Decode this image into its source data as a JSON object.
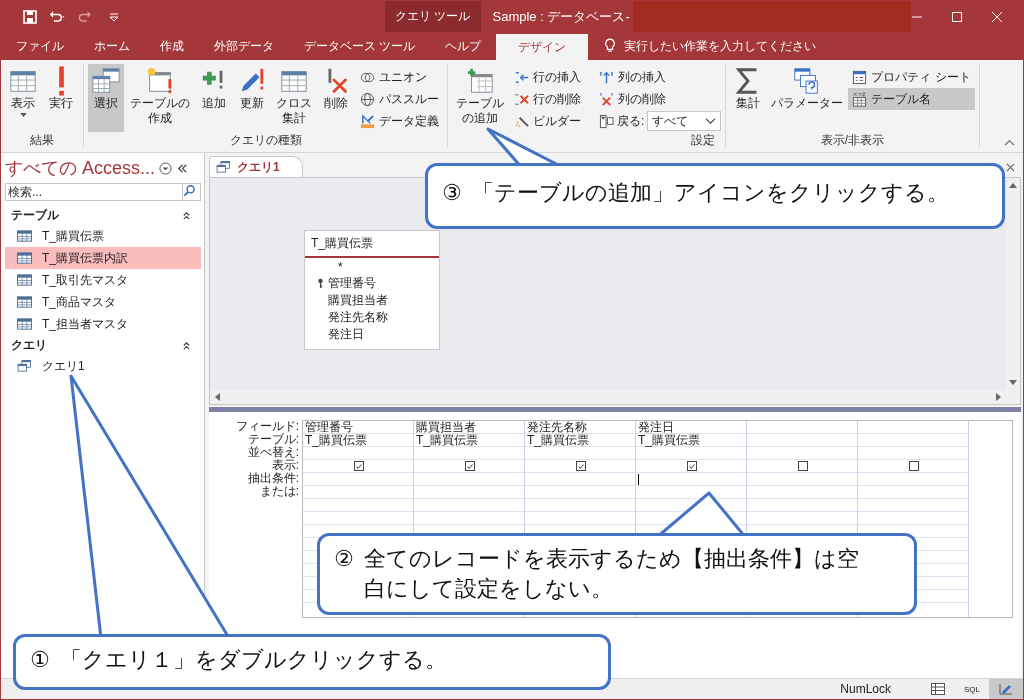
{
  "title_bar": {
    "context_tab": "クエリ ツール",
    "title": "Sample : データベース-"
  },
  "ribbon_tabs": [
    {
      "label": "ファイル",
      "selected": false
    },
    {
      "label": "ホーム",
      "selected": false
    },
    {
      "label": "作成",
      "selected": false
    },
    {
      "label": "外部データ",
      "selected": false
    },
    {
      "label": "データベース ツール",
      "selected": false
    },
    {
      "label": "ヘルプ",
      "selected": false
    },
    {
      "label": "デザイン",
      "selected": true
    }
  ],
  "tell_me": "実行したい作業を入力してください",
  "ribbon_groups": [
    {
      "label": "結果",
      "large": [
        {
          "label": "表示",
          "selected": false
        },
        {
          "label": "実行",
          "selected": false
        }
      ]
    },
    {
      "label": "クエリの種類",
      "large": [
        {
          "label": "選択",
          "selected": true
        },
        {
          "label": "テーブルの作成",
          "selected": false
        },
        {
          "label": "追加",
          "selected": false
        },
        {
          "label": "更新",
          "selected": false
        },
        {
          "label": "クロス集計",
          "selected": false
        },
        {
          "label": "削除",
          "selected": false
        }
      ],
      "small": [
        {
          "label": "ユニオン",
          "selected": false
        },
        {
          "label": "パススルー",
          "selected": false
        },
        {
          "label": "データ定義",
          "selected": false
        }
      ]
    },
    {
      "label": "設定",
      "large": [
        {
          "label": "テーブルの追加",
          "selected": false
        }
      ],
      "small": [
        {
          "label": "行の挿入",
          "selected": false
        },
        {
          "label": "行の削除",
          "selected": false
        },
        {
          "label": "ビルダー",
          "selected": false
        },
        {
          "label": "列の挿入",
          "selected": false
        },
        {
          "label": "列の削除",
          "selected": false
        }
      ],
      "dropdown": {
        "label": "戻る:",
        "value": "すべて"
      }
    },
    {
      "label": "表示/非表示",
      "large": [
        {
          "label": "集計",
          "selected": false
        },
        {
          "label": "パラメーター",
          "selected": false
        }
      ],
      "small": [
        {
          "label": "プロパティ シート",
          "selected": false
        },
        {
          "label": "テーブル名",
          "selected": true
        }
      ]
    }
  ],
  "nav": {
    "title": "すべての Access...",
    "search_placeholder": "検索...",
    "sections": [
      {
        "label": "テーブル",
        "kind": "table",
        "expanded": true,
        "items": [
          {
            "label": "T_購買伝票",
            "selected": false
          },
          {
            "label": "T_購買伝票内訳",
            "selected": true
          },
          {
            "label": "T_取引先マスタ",
            "selected": false
          },
          {
            "label": "T_商品マスタ",
            "selected": false
          },
          {
            "label": "T_担当者マスタ",
            "selected": false
          }
        ]
      },
      {
        "label": "クエリ",
        "kind": "query",
        "expanded": true,
        "items": [
          {
            "label": "クエリ1",
            "selected": false
          }
        ]
      }
    ]
  },
  "document_tab": {
    "label": "クエリ1",
    "selected": true
  },
  "table_box": {
    "title": "T_購買伝票",
    "fields": [
      {
        "name": "*",
        "key": false
      },
      {
        "name": "管理番号",
        "key": true
      },
      {
        "name": "購買担当者",
        "key": false
      },
      {
        "name": "発注先名称",
        "key": false
      },
      {
        "name": "発注日",
        "key": false
      }
    ]
  },
  "grid": {
    "row_labels": [
      "フィールド:",
      "テーブル:",
      "並べ替え:",
      "表示:",
      "抽出条件:",
      "または:"
    ],
    "columns": [
      {
        "field": "管理番号",
        "table": "T_購買伝票",
        "show": true,
        "cursor": false
      },
      {
        "field": "購買担当者",
        "table": "T_購買伝票",
        "show": true,
        "cursor": false
      },
      {
        "field": "発注先名称",
        "table": "T_購買伝票",
        "show": true,
        "cursor": false
      },
      {
        "field": "発注日",
        "table": "T_購買伝票",
        "show": true,
        "cursor": true
      },
      {
        "show": false,
        "cursor": false
      },
      {
        "show": false,
        "cursor": false
      }
    ]
  },
  "status_bar": {
    "indicator": "NumLock",
    "views": [
      {
        "kind": "datasheet",
        "selected": false
      },
      {
        "kind": "sql",
        "label": "SQL",
        "selected": false
      },
      {
        "kind": "design",
        "selected": true
      }
    ]
  },
  "callouts": [
    {
      "number": "③",
      "text": "「テーブルの追加」アイコンをクリックする。"
    },
    {
      "number": "②",
      "text": "全てのレコードを表示するため【抽出条件】は空白にして設定をしない。"
    },
    {
      "number": "①",
      "text": "「クエリ１」をダブルクリックする。"
    }
  ]
}
